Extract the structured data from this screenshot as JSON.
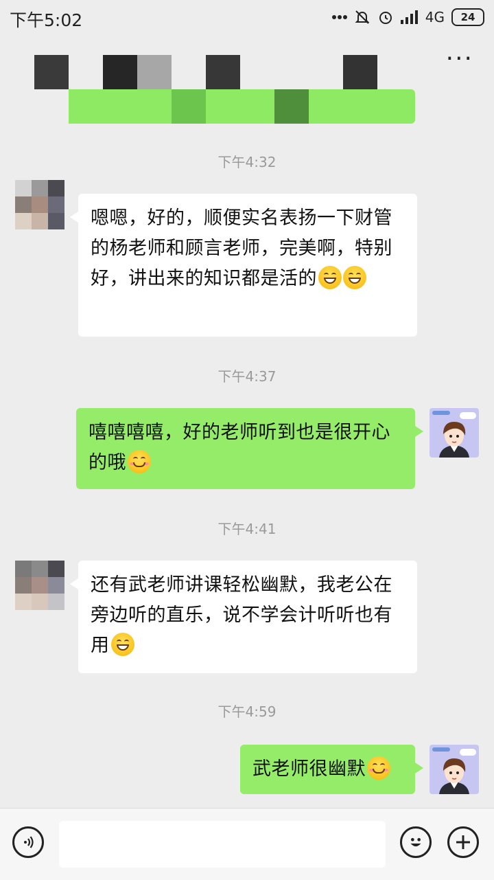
{
  "status_bar": {
    "time": "下午5:02",
    "network": "4G",
    "battery": "24"
  },
  "header": {
    "more_label": "···"
  },
  "messages": [
    {
      "time": "下午4:32",
      "side": "in",
      "text": "嗯嗯，好的，顺便实名表扬一下财管的杨老师和顾言老师，完美啊，特别好，讲出来的知识都是活的"
    },
    {
      "time": "下午4:37",
      "side": "out",
      "text": "嘻嘻嘻嘻，好的老师听到也是很开心的哦"
    },
    {
      "time": "下午4:41",
      "side": "in",
      "text": "还有武老师讲课轻松幽默，我老公在旁边听的直乐，说不学会计听听也有用"
    },
    {
      "time": "下午4:59",
      "side": "out",
      "text": "武老师很幽默"
    }
  ],
  "icons": {
    "status": [
      "dots-icon",
      "mute-icon",
      "alarm-icon",
      "signal-icon",
      "battery-icon"
    ],
    "input": [
      "voice-icon",
      "emoji-icon",
      "plus-icon"
    ]
  },
  "colors": {
    "background": "#ededed",
    "bubble_out": "#95ec69",
    "bubble_in": "#ffffff"
  }
}
